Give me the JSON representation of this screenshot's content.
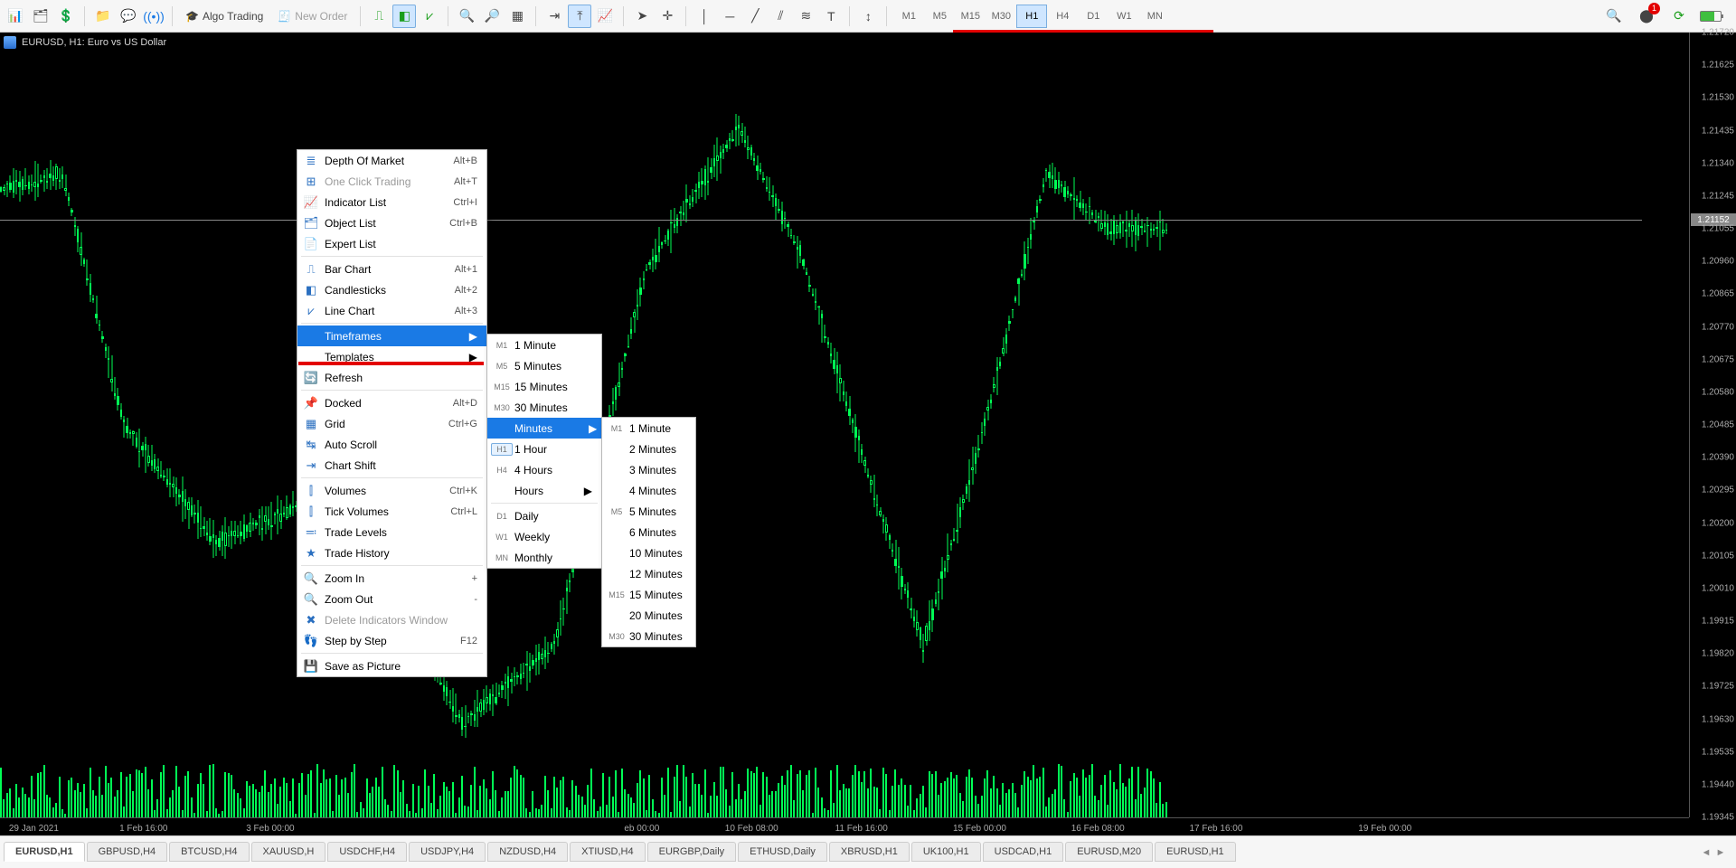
{
  "toolbar": {
    "algo_label": "Algo Trading",
    "new_order_label": "New Order",
    "timeframe_buttons": [
      "M1",
      "M5",
      "M15",
      "M30",
      "H1",
      "H4",
      "D1",
      "W1",
      "MN"
    ],
    "active_timeframe": "H1",
    "notif_count": "1"
  },
  "chart": {
    "title": "EURUSD, H1:  Euro vs US Dollar",
    "price_ticks": [
      "1.21720",
      "1.21625",
      "1.21530",
      "1.21435",
      "1.21340",
      "1.21245",
      "1.21055",
      "1.20960",
      "1.20865",
      "1.20770",
      "1.20675",
      "1.20580",
      "1.20485",
      "1.20390",
      "1.20295",
      "1.20200",
      "1.20105",
      "1.20010",
      "1.19915",
      "1.19820",
      "1.19725",
      "1.19630",
      "1.19535",
      "1.19440",
      "1.19345"
    ],
    "current_price": "1.21152",
    "time_ticks": [
      "29 Jan 2021",
      "1 Feb 16:00",
      "3 Feb 00:00",
      "eb 00:00",
      "10 Feb 08:00",
      "11 Feb 16:00",
      "15 Feb 00:00",
      "16 Feb 08:00",
      "17 Feb 16:00",
      "19 Feb 00:00"
    ]
  },
  "context_menu": {
    "items": [
      {
        "icon": "≣",
        "label": "Depth Of Market",
        "shortcut": "Alt+B"
      },
      {
        "icon": "⊞",
        "label": "One Click Trading",
        "shortcut": "Alt+T",
        "disabled": true
      },
      {
        "icon": "📈",
        "label": "Indicator List",
        "shortcut": "Ctrl+I"
      },
      {
        "icon": "🗂",
        "label": "Object List",
        "shortcut": "Ctrl+B"
      },
      {
        "icon": "📄",
        "label": "Expert List"
      },
      {
        "sep": true
      },
      {
        "icon": "⎍",
        "label": "Bar Chart",
        "shortcut": "Alt+1"
      },
      {
        "icon": "◧",
        "label": "Candlesticks",
        "shortcut": "Alt+2"
      },
      {
        "icon": "⩗",
        "label": "Line Chart",
        "shortcut": "Alt+3"
      },
      {
        "sep": true
      },
      {
        "label": "Timeframes",
        "submenu": true,
        "highlight": true
      },
      {
        "label": "Templates",
        "submenu": true
      },
      {
        "icon": "🔄",
        "label": "Refresh"
      },
      {
        "sep": true
      },
      {
        "icon": "📌",
        "label": "Docked",
        "shortcut": "Alt+D"
      },
      {
        "icon": "▦",
        "label": "Grid",
        "shortcut": "Ctrl+G"
      },
      {
        "icon": "↹",
        "label": "Auto Scroll"
      },
      {
        "icon": "⇥",
        "label": "Chart Shift"
      },
      {
        "sep": true
      },
      {
        "icon": "⫿",
        "label": "Volumes",
        "shortcut": "Ctrl+K"
      },
      {
        "icon": "⫿",
        "label": "Tick Volumes",
        "shortcut": "Ctrl+L"
      },
      {
        "icon": "≕",
        "label": "Trade Levels"
      },
      {
        "icon": "★",
        "label": "Trade History"
      },
      {
        "sep": true
      },
      {
        "icon": "🔍",
        "label": "Zoom In",
        "shortcut": "+"
      },
      {
        "icon": "🔍",
        "label": "Zoom Out",
        "shortcut": "-"
      },
      {
        "icon": "✖",
        "label": "Delete Indicators Window",
        "disabled": true
      },
      {
        "icon": "👣",
        "label": "Step by Step",
        "shortcut": "F12"
      },
      {
        "sep": true
      },
      {
        "icon": "💾",
        "label": "Save as Picture"
      }
    ]
  },
  "sub_tf": {
    "items": [
      {
        "b": "M1",
        "label": "1 Minute"
      },
      {
        "b": "M5",
        "label": "5 Minutes"
      },
      {
        "b": "M15",
        "label": "15 Minutes"
      },
      {
        "b": "M30",
        "label": "30 Minutes"
      },
      {
        "label": "Minutes",
        "submenu": true,
        "highlight": true
      },
      {
        "b": "H1",
        "label": "1 Hour",
        "sel": true
      },
      {
        "b": "H4",
        "label": "4 Hours"
      },
      {
        "label": "Hours",
        "submenu": true
      },
      {
        "sep": true
      },
      {
        "b": "D1",
        "label": "Daily"
      },
      {
        "b": "W1",
        "label": "Weekly"
      },
      {
        "b": "MN",
        "label": "Monthly"
      }
    ]
  },
  "sub_min": {
    "items": [
      {
        "b": "M1",
        "label": "1 Minute"
      },
      {
        "label": "2 Minutes"
      },
      {
        "label": "3 Minutes"
      },
      {
        "label": "4 Minutes"
      },
      {
        "b": "M5",
        "label": "5 Minutes"
      },
      {
        "label": "6 Minutes"
      },
      {
        "label": "10 Minutes"
      },
      {
        "label": "12 Minutes"
      },
      {
        "b": "M15",
        "label": "15 Minutes"
      },
      {
        "label": "20 Minutes"
      },
      {
        "b": "M30",
        "label": "30 Minutes"
      }
    ]
  },
  "tabs": [
    "EURUSD,H1",
    "GBPUSD,H4",
    "BTCUSD,H4",
    "XAUUSD,H",
    "USDCHF,H4",
    "USDJPY,H4",
    "NZDUSD,H4",
    "XTIUSD,H4",
    "EURGBP,Daily",
    "ETHUSD,Daily",
    "XBRUSD,H1",
    "UK100,H1",
    "USDCAD,H1",
    "EURUSD,M20",
    "EURUSD,H1"
  ],
  "active_tab": 0,
  "chart_data": {
    "type": "candlestick",
    "symbol": "EURUSD",
    "timeframe": "H1",
    "y_range": [
      1.19345,
      1.2172
    ],
    "current_bid": 1.21152,
    "x_labels": [
      "29 Jan 2021",
      "1 Feb 16:00",
      "3 Feb 00:00",
      "10 Feb 08:00",
      "11 Feb 16:00",
      "15 Feb 00:00",
      "16 Feb 08:00",
      "17 Feb 16:00",
      "19 Feb 00:00"
    ],
    "note": "Hourly OHLC candles Jan 29 – Feb 19 2021; approx 380 bars; price ranged roughly 1.1955–1.2170; volume bars along bottom."
  }
}
